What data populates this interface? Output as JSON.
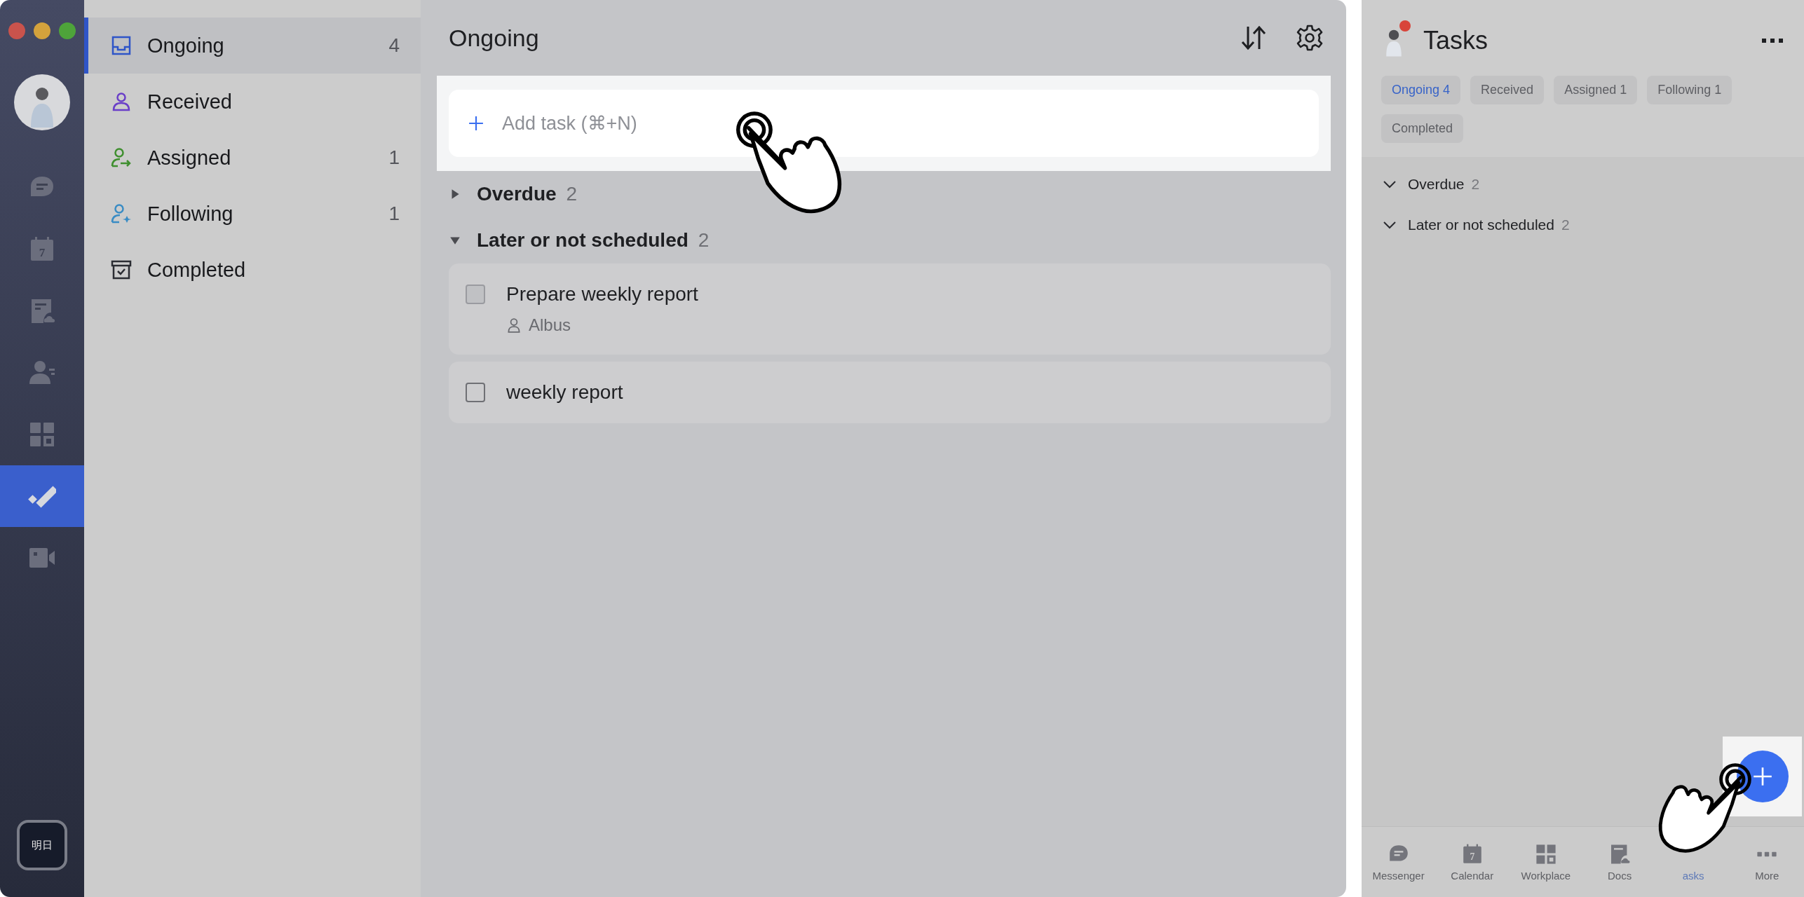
{
  "rail": {
    "items": [
      {
        "selected": false
      },
      {
        "selected": false,
        "day": "7"
      },
      {
        "selected": false
      },
      {
        "selected": false
      },
      {
        "selected": false
      },
      {
        "selected": true
      },
      {
        "selected": false
      }
    ],
    "badge": "明日"
  },
  "nav": {
    "items": [
      {
        "label": "Ongoing",
        "count": "4",
        "selected": true
      },
      {
        "label": "Received",
        "selected": false
      },
      {
        "label": "Assigned",
        "count": "1",
        "selected": false
      },
      {
        "label": "Following",
        "count": "1",
        "selected": false
      },
      {
        "label": "Completed",
        "selected": false
      }
    ]
  },
  "main": {
    "title": "Ongoing",
    "add_task": {
      "placeholder": "Add task (⌘+N)"
    },
    "groups": [
      {
        "title": "Overdue",
        "count": "2",
        "expanded": false
      },
      {
        "title": "Later or not scheduled",
        "count": "2",
        "expanded": true,
        "tasks": [
          {
            "title": "Prepare weekly report",
            "checked": false,
            "assignee": "Albus"
          },
          {
            "title": "weekly report",
            "checked": false
          }
        ]
      }
    ]
  },
  "mobile": {
    "title": "Tasks",
    "notification": true,
    "filters": [
      {
        "label": "Ongoing 4",
        "selected": true
      },
      {
        "label": "Received",
        "selected": false
      },
      {
        "label": "Assigned 1",
        "selected": false
      },
      {
        "label": "Following 1",
        "selected": false
      },
      {
        "label": "Completed",
        "selected": false
      }
    ],
    "groups": [
      {
        "title": "Overdue",
        "count": "2",
        "expanded": true
      },
      {
        "title": "Later or not scheduled",
        "count": "2",
        "expanded": true
      }
    ],
    "tabs": [
      {
        "label": "Messenger",
        "selected": false
      },
      {
        "label": "Calendar",
        "selected": false,
        "day": "7"
      },
      {
        "label": "Workplace",
        "selected": false
      },
      {
        "label": "Docs",
        "selected": false
      },
      {
        "label": "asks",
        "selected": true
      },
      {
        "label": "More",
        "selected": false
      }
    ]
  }
}
